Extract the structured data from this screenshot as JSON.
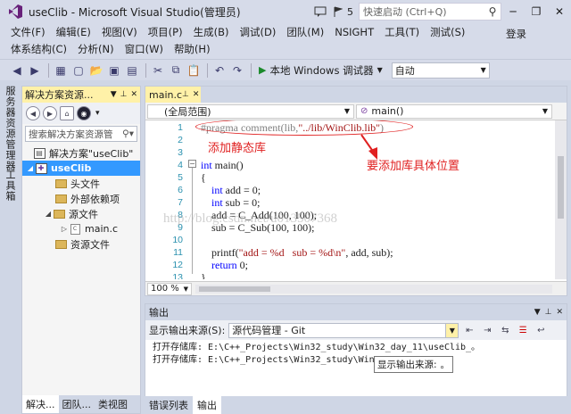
{
  "title_bar": {
    "app_title": "useClib - Microsoft Visual Studio(管理员)",
    "notification_count": "5",
    "quick_launch_placeholder": "快速启动 (Ctrl+Q)"
  },
  "menu": {
    "row1": [
      "文件(F)",
      "编辑(E)",
      "视图(V)",
      "项目(P)",
      "生成(B)",
      "调试(D)",
      "团队(M)",
      "NSIGHT",
      "工具(T)",
      "测试(S)"
    ],
    "row2": [
      "体系结构(C)",
      "分析(N)",
      "窗口(W)",
      "帮助(H)"
    ],
    "login": "登录"
  },
  "toolbar": {
    "run_label": "本地 Windows 调试器",
    "config_value": "自动"
  },
  "left_strip": {
    "tab1": "服务器资源管理器",
    "tab2": "工具箱"
  },
  "solution_explorer": {
    "title": "解决方案资源...",
    "search_placeholder": "搜索解决方案资源管",
    "tree": [
      {
        "label": "解决方案\"useClib\"",
        "level": 0,
        "type": "solution"
      },
      {
        "label": "useClib",
        "level": 1,
        "type": "project",
        "selected": true
      },
      {
        "label": "头文件",
        "level": 2,
        "type": "folder"
      },
      {
        "label": "外部依赖项",
        "level": 2,
        "type": "folder"
      },
      {
        "label": "源文件",
        "level": 2,
        "type": "folder"
      },
      {
        "label": "main.c",
        "level": 3,
        "type": "cfile"
      },
      {
        "label": "资源文件",
        "level": 2,
        "type": "folder"
      }
    ],
    "tabs": [
      "解决...",
      "团队...",
      "类视图"
    ]
  },
  "editor": {
    "tab_label": "main.c",
    "scope_select": "(全局范围)",
    "function_select": "main()",
    "zoom": "100 %",
    "lines": [
      {
        "n": "1",
        "text": "#pragma comment(lib,\"../lib/WinClib.lib\")"
      },
      {
        "n": "2",
        "text": ""
      },
      {
        "n": "3",
        "text": ""
      },
      {
        "n": "4",
        "text": "int main()"
      },
      {
        "n": "5",
        "text": "{"
      },
      {
        "n": "6",
        "text": "    int add = 0;"
      },
      {
        "n": "7",
        "text": "    int sub = 0;"
      },
      {
        "n": "8",
        "text": "    add = C_Add(100, 100);"
      },
      {
        "n": "9",
        "text": "    sub = C_Sub(100, 100);"
      },
      {
        "n": "10",
        "text": ""
      },
      {
        "n": "11",
        "text": "    printf(\"add = %d   sub = %d\\n\", add, sub);"
      },
      {
        "n": "12",
        "text": "    return 0;"
      },
      {
        "n": "13",
        "text": "}"
      }
    ],
    "annotation_static": "添加静态库",
    "annotation_path": "要添加库具体位置",
    "watermark": "http://blog.csdn.net/u013507368"
  },
  "output": {
    "title": "输出",
    "source_label": "显示输出来源(S):",
    "source_value": "源代码管理 - Git",
    "lines": [
      "打开存储库:  E:\\C++_Projects\\Win32_study\\Win32_day_11\\useClib_。",
      "打开存储库:  E:\\C++_Projects\\Win32_study\\Win32_"
    ],
    "tooltip": "显示输出来源:",
    "tooltip_suffix": "。",
    "tabs": [
      "错误列表",
      "输出"
    ]
  }
}
